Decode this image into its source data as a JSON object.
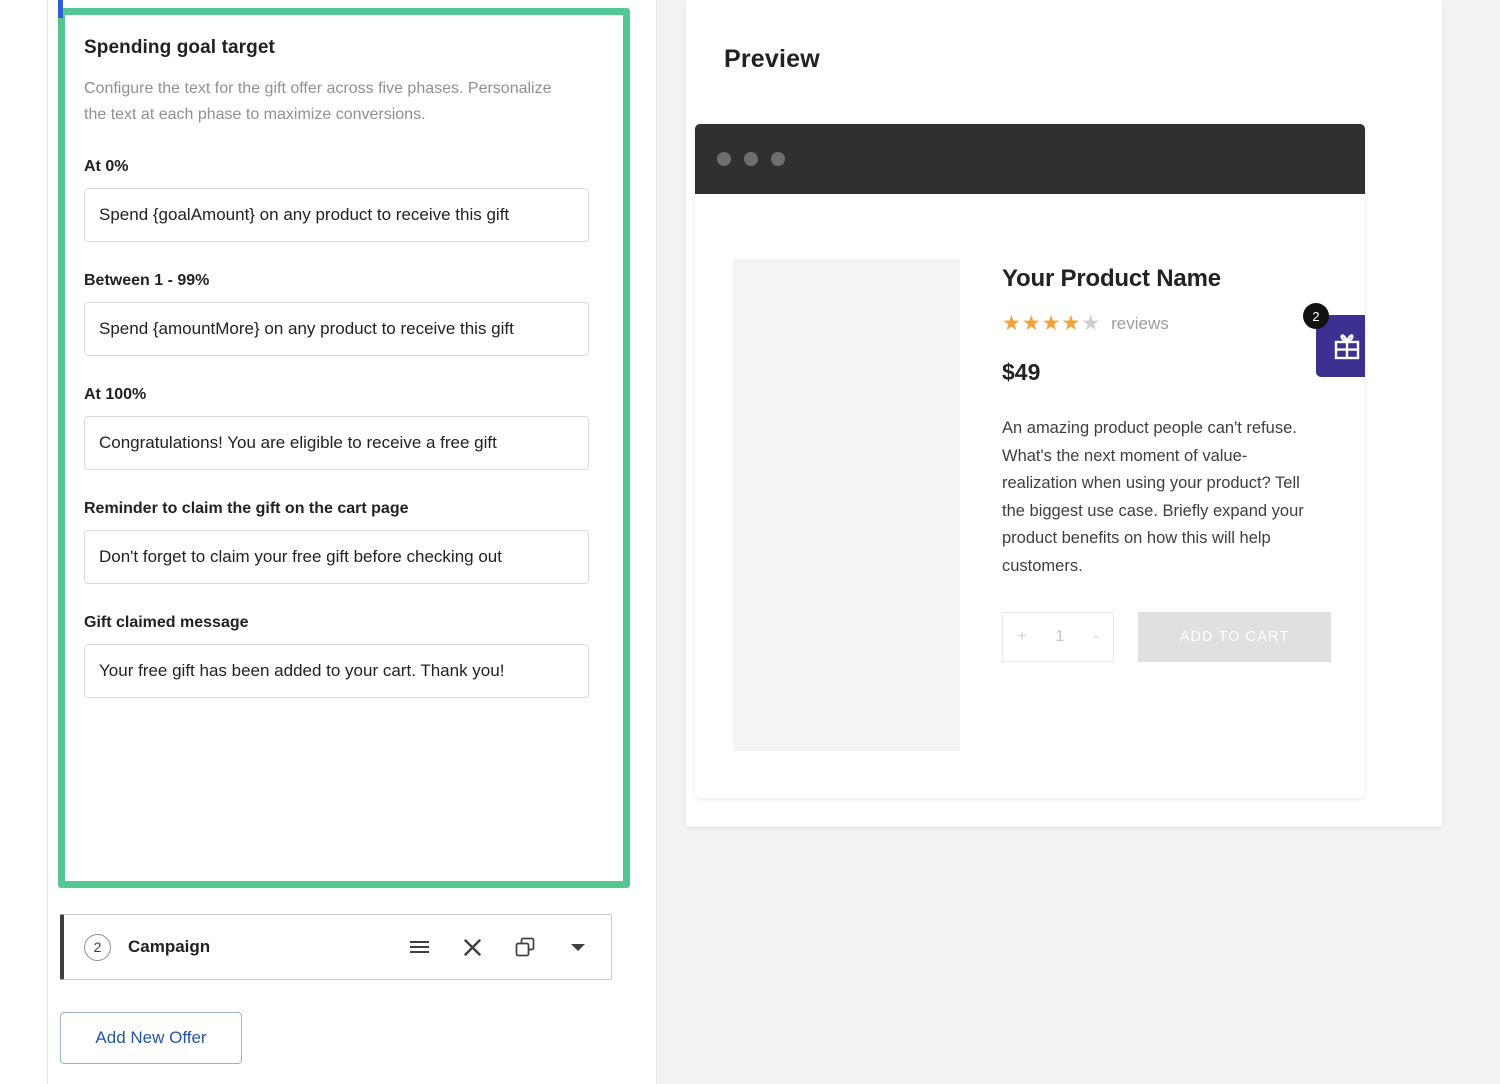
{
  "offer_editor": {
    "title": "Spending goal target",
    "description": "Configure the text for the gift offer across five phases. Personalize the text at each phase to maximize conversions.",
    "fields": [
      {
        "label": "At 0%",
        "name": "at-0-percent",
        "value": "Spend {goalAmount} on any product to receive this gift"
      },
      {
        "label": "Between 1 - 99%",
        "name": "between-1-99-percent",
        "value": "Spend {amountMore} on any product to receive this gift"
      },
      {
        "label": "At 100%",
        "name": "at-100-percent",
        "value": "Congratulations! You are eligible to receive a free gift"
      },
      {
        "label": "Reminder to claim the gift on the cart page",
        "name": "cart-page-reminder",
        "value": "Don't forget to claim your free gift before checking out"
      },
      {
        "label": "Gift claimed message",
        "name": "gift-claimed-message",
        "value": "Your free gift has been added to your cart. Thank you!"
      }
    ]
  },
  "campaign_row": {
    "number": "2",
    "label": "Campaign",
    "actions": [
      {
        "name": "drag-handle-icon",
        "glyph": "≡"
      },
      {
        "name": "close-icon",
        "glyph": "✕"
      },
      {
        "name": "duplicate-icon",
        "glyph": "duplicate"
      },
      {
        "name": "chevron-down-icon",
        "glyph": "▾"
      }
    ]
  },
  "add_offer_button": {
    "label": "Add New Offer"
  },
  "preview": {
    "title": "Preview",
    "browser_dots": 3,
    "product": {
      "name": "Your Product Name",
      "rating_filled": 4,
      "rating_total": 5,
      "reviews_label": "reviews",
      "price": "$49",
      "description": "An amazing product people can't refuse. What's the next moment of value-realization when using your product? Tell the biggest use case. Briefly expand your product benefits on how this will help customers.",
      "quantity_increase": "+",
      "quantity_value": "1",
      "quantity_decrease": "-",
      "add_to_cart_label": "ADD TO CART"
    },
    "gift_widget": {
      "badge_count": "2",
      "icon": "gift-icon"
    }
  },
  "colors": {
    "active_card_border": "#53c793",
    "blue_tab": "#2c5dd4",
    "gift_widget": "#3c3191",
    "star_filled": "#f2a33c",
    "star_empty": "#cdcdcd",
    "link_blue": "#2355a8",
    "browser_chrome": "#2f3032",
    "preview_bg": "#f1f2f4"
  }
}
